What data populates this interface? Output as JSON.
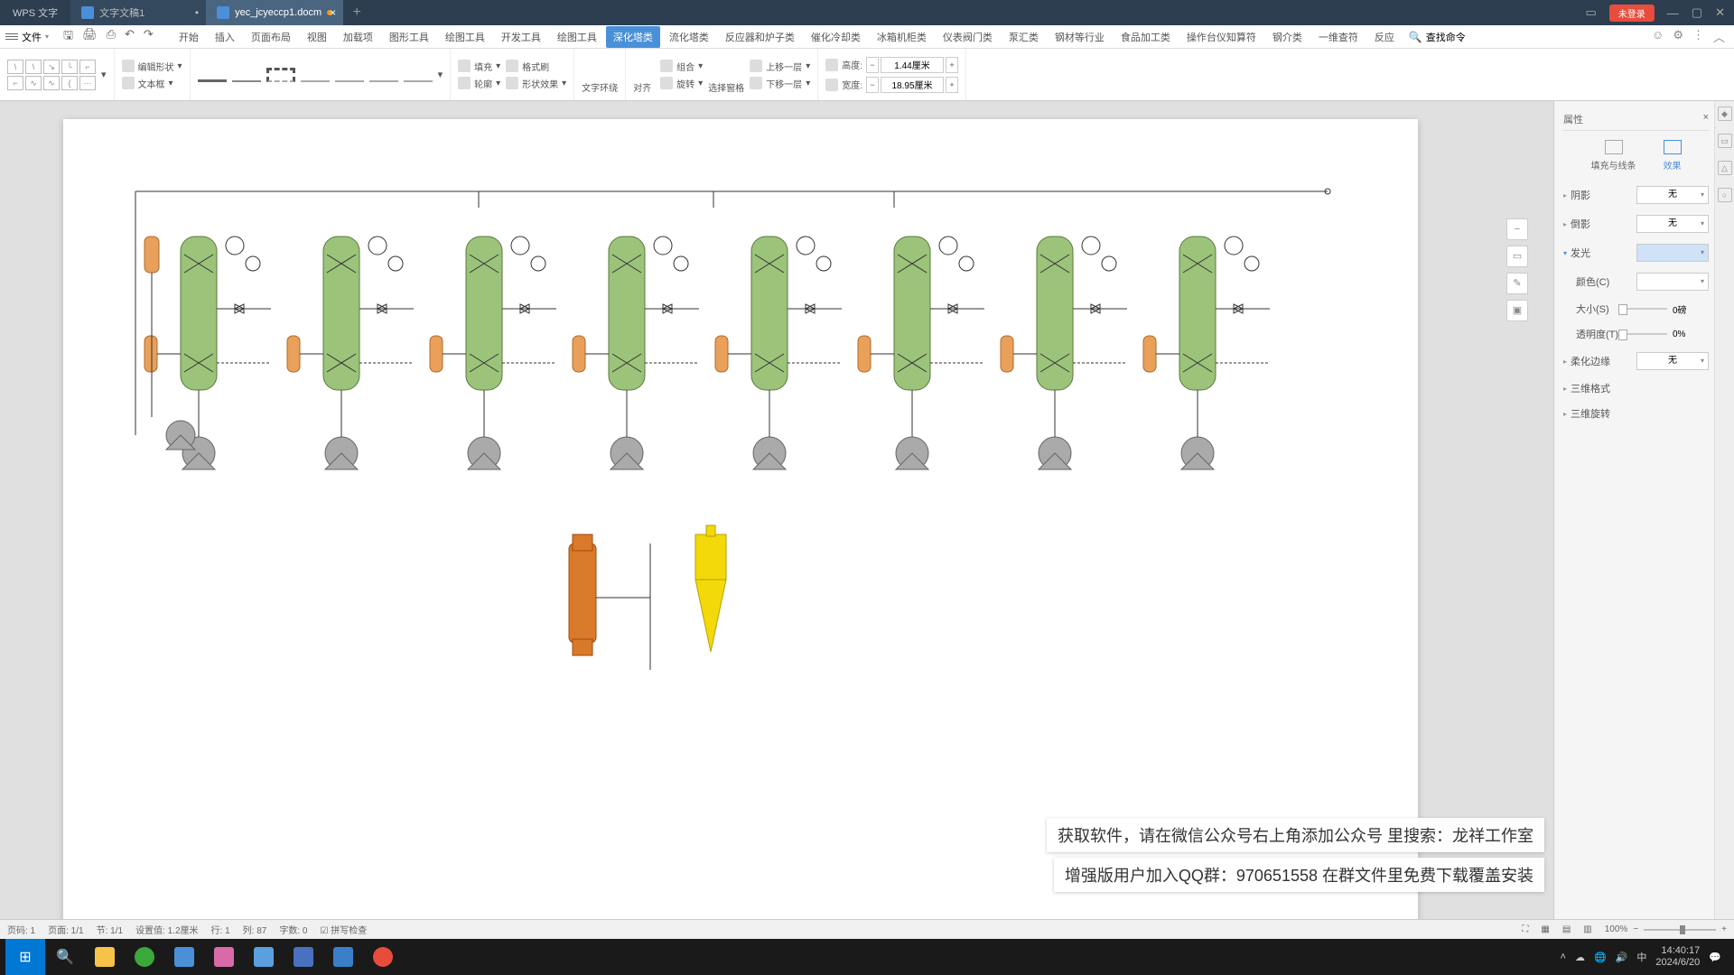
{
  "titlebar": {
    "app": "WPS 文字",
    "tabs": [
      {
        "label": "文字文稿1",
        "active": false
      },
      {
        "label": "yec_jcyeccp1.docm",
        "active": true
      }
    ]
  },
  "login_pill": "未登录",
  "menu": {
    "file": "文件",
    "items": [
      "开始",
      "插入",
      "页面布局",
      "视图",
      "加载项",
      "图形工具",
      "绘图工具",
      "开发工具",
      "绘图工具",
      "深化塔类",
      "流化塔类",
      "反应器和炉子类",
      "催化冷却类",
      "冰箱机柜类",
      "仪表阀门类",
      "泵汇类",
      "钢材等行业",
      "食品加工类",
      "操作台仪知算符",
      "钢介类",
      "一维查符",
      "反应"
    ],
    "active_index": 9,
    "search_placeholder": "查找命令"
  },
  "ribbon": {
    "edit_shape": "编辑形状",
    "textbox": "文本框",
    "fill": "填充",
    "outline": "轮廓",
    "format_painter": "格式刷",
    "shape_effect": "形状效果",
    "text_wrap": "文字环绕",
    "align": "对齐",
    "rotate": "旋转",
    "group": "组合",
    "selection_pane": "选择窗格",
    "up_layer": "上移一层",
    "down_layer": "下移一层",
    "height_label": "高度:",
    "width_label": "宽度:",
    "height_val": "1.44厘米",
    "width_val": "18.95厘米"
  },
  "props": {
    "title": "属性",
    "tab_fill": "填充与线条",
    "tab_effect": "效果",
    "shadow": "阴影",
    "shadow_val": "无",
    "reflect": "倒影",
    "reflect_val": "无",
    "glow": "发光",
    "color": "颜色(C)",
    "size": "大小(S)",
    "size_val": "0磅",
    "trans": "透明度(T)",
    "trans_val": "0%",
    "soft": "柔化边缘",
    "soft_val": "无",
    "threeD": "三维格式",
    "threeDrot": "三维旋转"
  },
  "banners": {
    "line1": "获取软件，请在微信公众号右上角添加公众号 里搜索：龙祥工作室",
    "line2": "增强版用户加入QQ群：970651558  在群文件里免费下载覆盖安装"
  },
  "status": {
    "page": "页码: 1",
    "pages": "页面: 1/1",
    "section": "节: 1/1",
    "pos": "设置值: 1.2厘米",
    "line": "行: 1",
    "col": "列: 87",
    "chars": "字数: 0",
    "spell": "拼写检查",
    "zoom": "100%"
  },
  "clock": {
    "time": "14:40:17",
    "date": "2024/6/20"
  }
}
